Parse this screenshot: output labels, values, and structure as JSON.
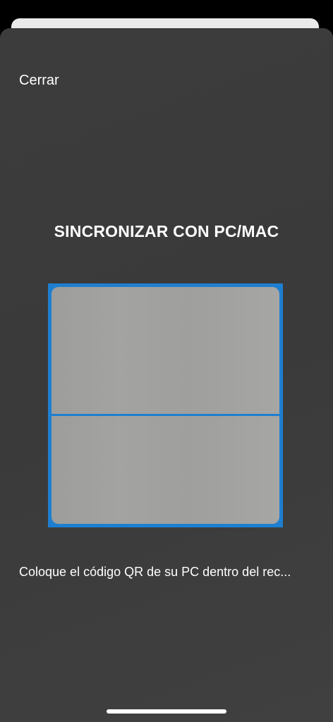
{
  "modal": {
    "close_label": "Cerrar",
    "title": "SINCRONIZAR CON PC/MAC",
    "instruction": "Coloque el código QR de su PC dentro del rec..."
  },
  "scanner": {
    "frame_color": "#1e7fd0",
    "scan_line_color": "#1e7fd0"
  },
  "colors": {
    "sheet_background": "#3c3c3c",
    "text": "#ffffff"
  }
}
